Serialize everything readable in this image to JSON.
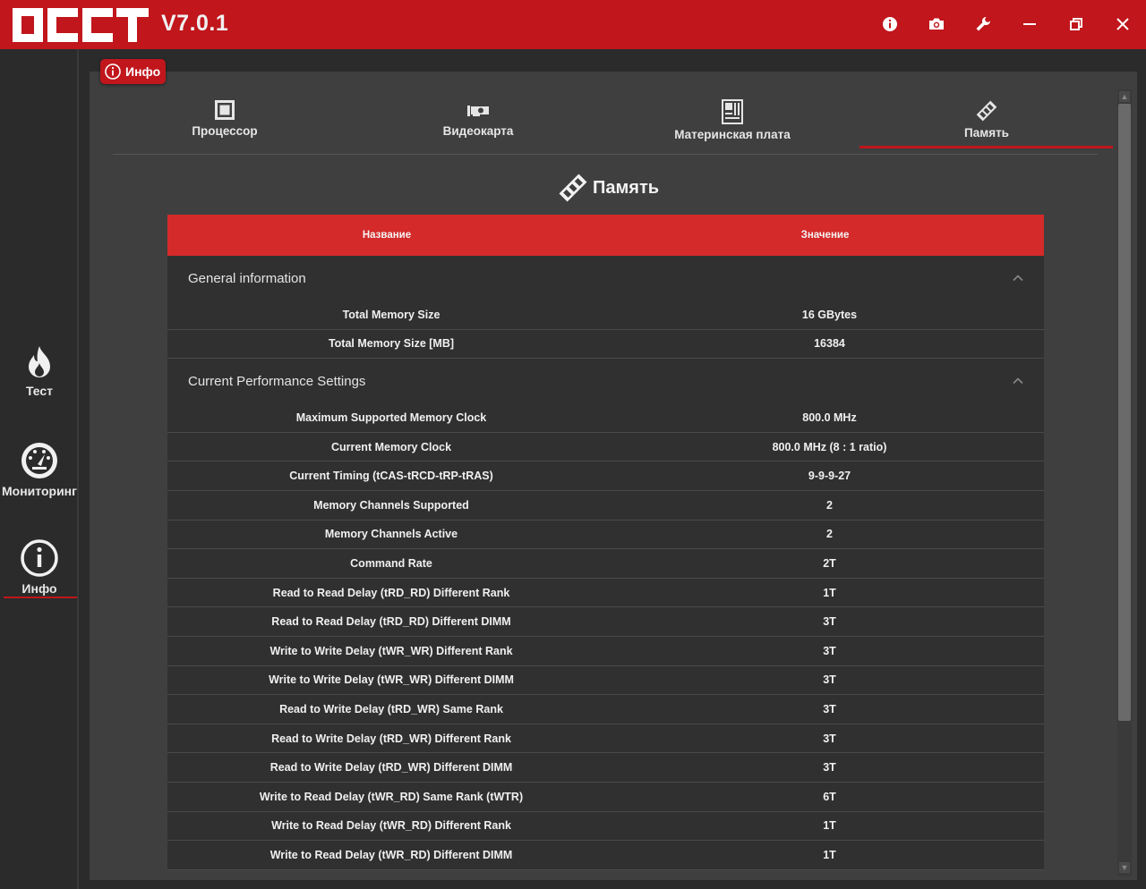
{
  "app": {
    "version": "V7.0.1",
    "logo_text": "OCCT"
  },
  "badge": {
    "label": "Инфо"
  },
  "sidebar": {
    "items": [
      {
        "label": "Тест"
      },
      {
        "label": "Мониторинг"
      },
      {
        "label": "Инфо"
      }
    ]
  },
  "tabs": [
    {
      "label": "Процессор"
    },
    {
      "label": "Видеокарта"
    },
    {
      "label": "Материнская плата"
    },
    {
      "label": "Память"
    }
  ],
  "section": {
    "title": "Память"
  },
  "table": {
    "headers": {
      "name": "Название",
      "value": "Значение"
    },
    "groups": [
      {
        "title": "General information",
        "rows": [
          {
            "name": "Total Memory Size",
            "value": "16 GBytes"
          },
          {
            "name": "Total Memory Size [MB]",
            "value": "16384"
          }
        ]
      },
      {
        "title": "Current Performance Settings",
        "rows": [
          {
            "name": "Maximum Supported Memory Clock",
            "value": "800.0 MHz"
          },
          {
            "name": "Current Memory Clock",
            "value": "800.0 MHz (8 : 1 ratio)"
          },
          {
            "name": "Current Timing (tCAS-tRCD-tRP-tRAS)",
            "value": "9-9-9-27"
          },
          {
            "name": "Memory Channels Supported",
            "value": "2"
          },
          {
            "name": "Memory Channels Active",
            "value": "2"
          },
          {
            "name": "Command Rate",
            "value": "2T"
          },
          {
            "name": "Read to Read Delay (tRD_RD) Different Rank",
            "value": "1T"
          },
          {
            "name": "Read to Read Delay (tRD_RD) Different DIMM",
            "value": "3T"
          },
          {
            "name": "Write to Write Delay (tWR_WR) Different Rank",
            "value": "3T"
          },
          {
            "name": "Write to Write Delay (tWR_WR) Different DIMM",
            "value": "3T"
          },
          {
            "name": "Read to Write Delay (tRD_WR) Same Rank",
            "value": "3T"
          },
          {
            "name": "Read to Write Delay (tRD_WR) Different Rank",
            "value": "3T"
          },
          {
            "name": "Read to Write Delay (tRD_WR) Different DIMM",
            "value": "3T"
          },
          {
            "name": "Write to Read Delay (tWR_RD) Same Rank (tWTR)",
            "value": "6T"
          },
          {
            "name": "Write to Read Delay (tWR_RD) Different Rank",
            "value": "1T"
          },
          {
            "name": "Write to Read Delay (tWR_RD) Different DIMM",
            "value": "1T"
          }
        ]
      }
    ]
  },
  "colors": {
    "accent": "#c0161c",
    "header_red": "#d42a2a",
    "panel": "#3f3f3f",
    "row_bg": "#303030"
  },
  "icons": {
    "titlebar": [
      "info-icon",
      "camera-icon",
      "wrench-icon",
      "minimize-icon",
      "restore-icon",
      "close-icon"
    ],
    "sidebar": [
      "flame-icon",
      "gauge-icon",
      "info-circle-icon"
    ],
    "tabs": [
      "cpu-icon",
      "gpu-icon",
      "motherboard-icon",
      "memory-stick-icon"
    ]
  }
}
